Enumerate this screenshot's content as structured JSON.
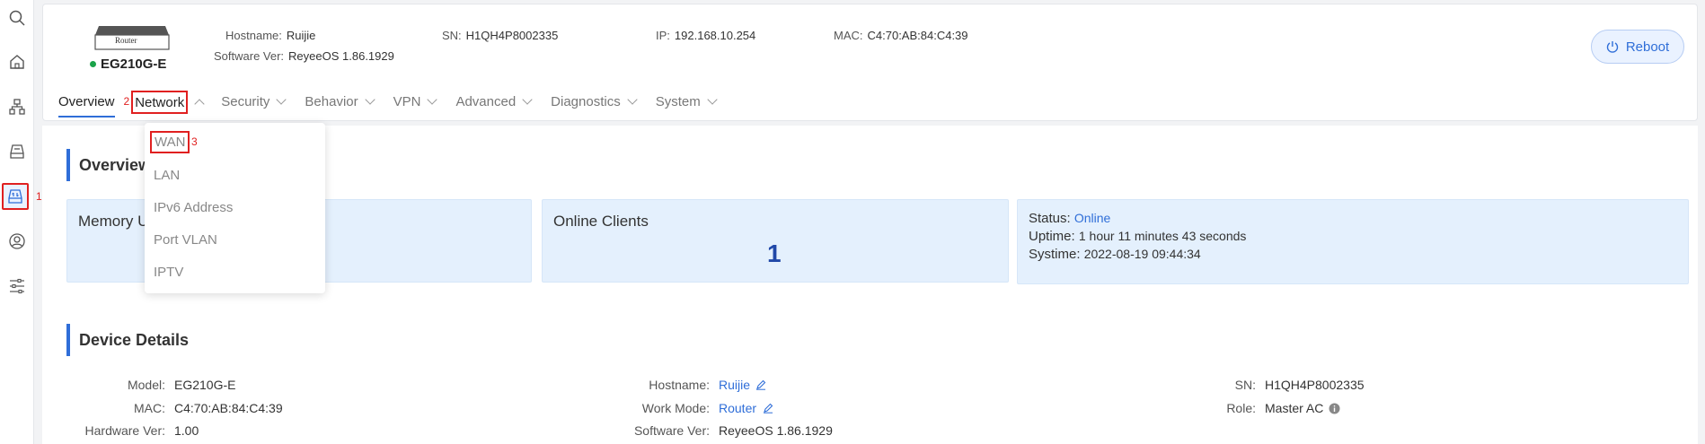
{
  "rail": {
    "items": [
      {
        "icon": "search-icon"
      },
      {
        "icon": "home-icon"
      },
      {
        "icon": "topology-icon"
      },
      {
        "icon": "device-icon"
      },
      {
        "icon": "router-config-icon"
      },
      {
        "icon": "user-icon"
      },
      {
        "icon": "settings-sliders-icon"
      }
    ],
    "marker": "1"
  },
  "device": {
    "image_label": "Router",
    "name": "EG210G-E",
    "status_color": "#1aa34a",
    "hostname_label": "Hostname:",
    "hostname": "Ruijie",
    "software_label": "Software Ver:",
    "software": "ReyeeOS 1.86.1929",
    "sn_label": "SN:",
    "sn": "H1QH4P8002335",
    "ip_label": "IP:",
    "ip": "192.168.10.254",
    "mac_label": "MAC:",
    "mac": "C4:70:AB:84:C4:39"
  },
  "reboot_label": "Reboot",
  "nav": {
    "overview": "Overview",
    "network": "Network",
    "network_marker": "2",
    "security": "Security",
    "behavior": "Behavior",
    "vpn": "VPN",
    "advanced": "Advanced",
    "diagnostics": "Diagnostics",
    "system": "System"
  },
  "dropdown": {
    "items": [
      "WAN",
      "LAN",
      "IPv6 Address",
      "Port VLAN",
      "IPTV"
    ],
    "wan_marker": "3"
  },
  "overview": {
    "title": "Overview",
    "memory_title": "Memory U",
    "clients_title": "Online Clients",
    "clients_count": "1",
    "status_label": "Status:",
    "status_value": "Online",
    "uptime_label": "Uptime:",
    "uptime_value": "1 hour 11 minutes 43 seconds",
    "systime_label": "Systime:",
    "systime_value": "2022-08-19 09:44:34"
  },
  "details": {
    "title": "Device Details",
    "model_label": "Model:",
    "model": "EG210G-E",
    "mac_label": "MAC:",
    "mac": "C4:70:AB:84:C4:39",
    "hw_label": "Hardware Ver:",
    "hw": "1.00",
    "hostname_label": "Hostname:",
    "hostname": "Ruijie",
    "workmode_label": "Work Mode:",
    "workmode": "Router",
    "software_label": "Software Ver:",
    "software": "ReyeeOS 1.86.1929",
    "sn_label": "SN:",
    "sn": "H1QH4P8002335",
    "role_label": "Role:",
    "role": "Master AC"
  },
  "colors": {
    "accent": "#2f6ed8",
    "highlight": "#e02020",
    "card_bg": "#e4f0fd"
  }
}
